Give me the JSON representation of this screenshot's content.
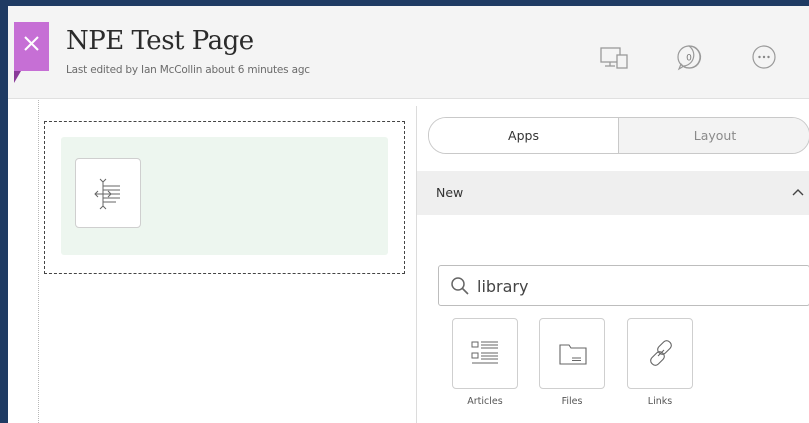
{
  "header": {
    "title": "NPE Test Page",
    "subtitle": "Last edited by Ian McCollin about 6 minutes agc",
    "close_icon": "close-icon",
    "device_icon": "device-preview-icon",
    "comments_count": "0",
    "more_icon": "more-options-icon"
  },
  "panel": {
    "tabs": [
      {
        "label": "Apps",
        "active": true
      },
      {
        "label": "Layout",
        "active": false
      }
    ],
    "section": {
      "label": "New",
      "expanded": true
    },
    "search": {
      "value": "library",
      "placeholder": ""
    },
    "apps": [
      {
        "label": "Articles",
        "icon": "articles-icon"
      },
      {
        "label": "Files",
        "icon": "folder-icon"
      },
      {
        "label": "Links",
        "icon": "link-icon"
      }
    ]
  },
  "colors": {
    "close_tab": "#c66fd5",
    "module_bg": "#edf6ef",
    "frame_border": "#1f3b63"
  }
}
